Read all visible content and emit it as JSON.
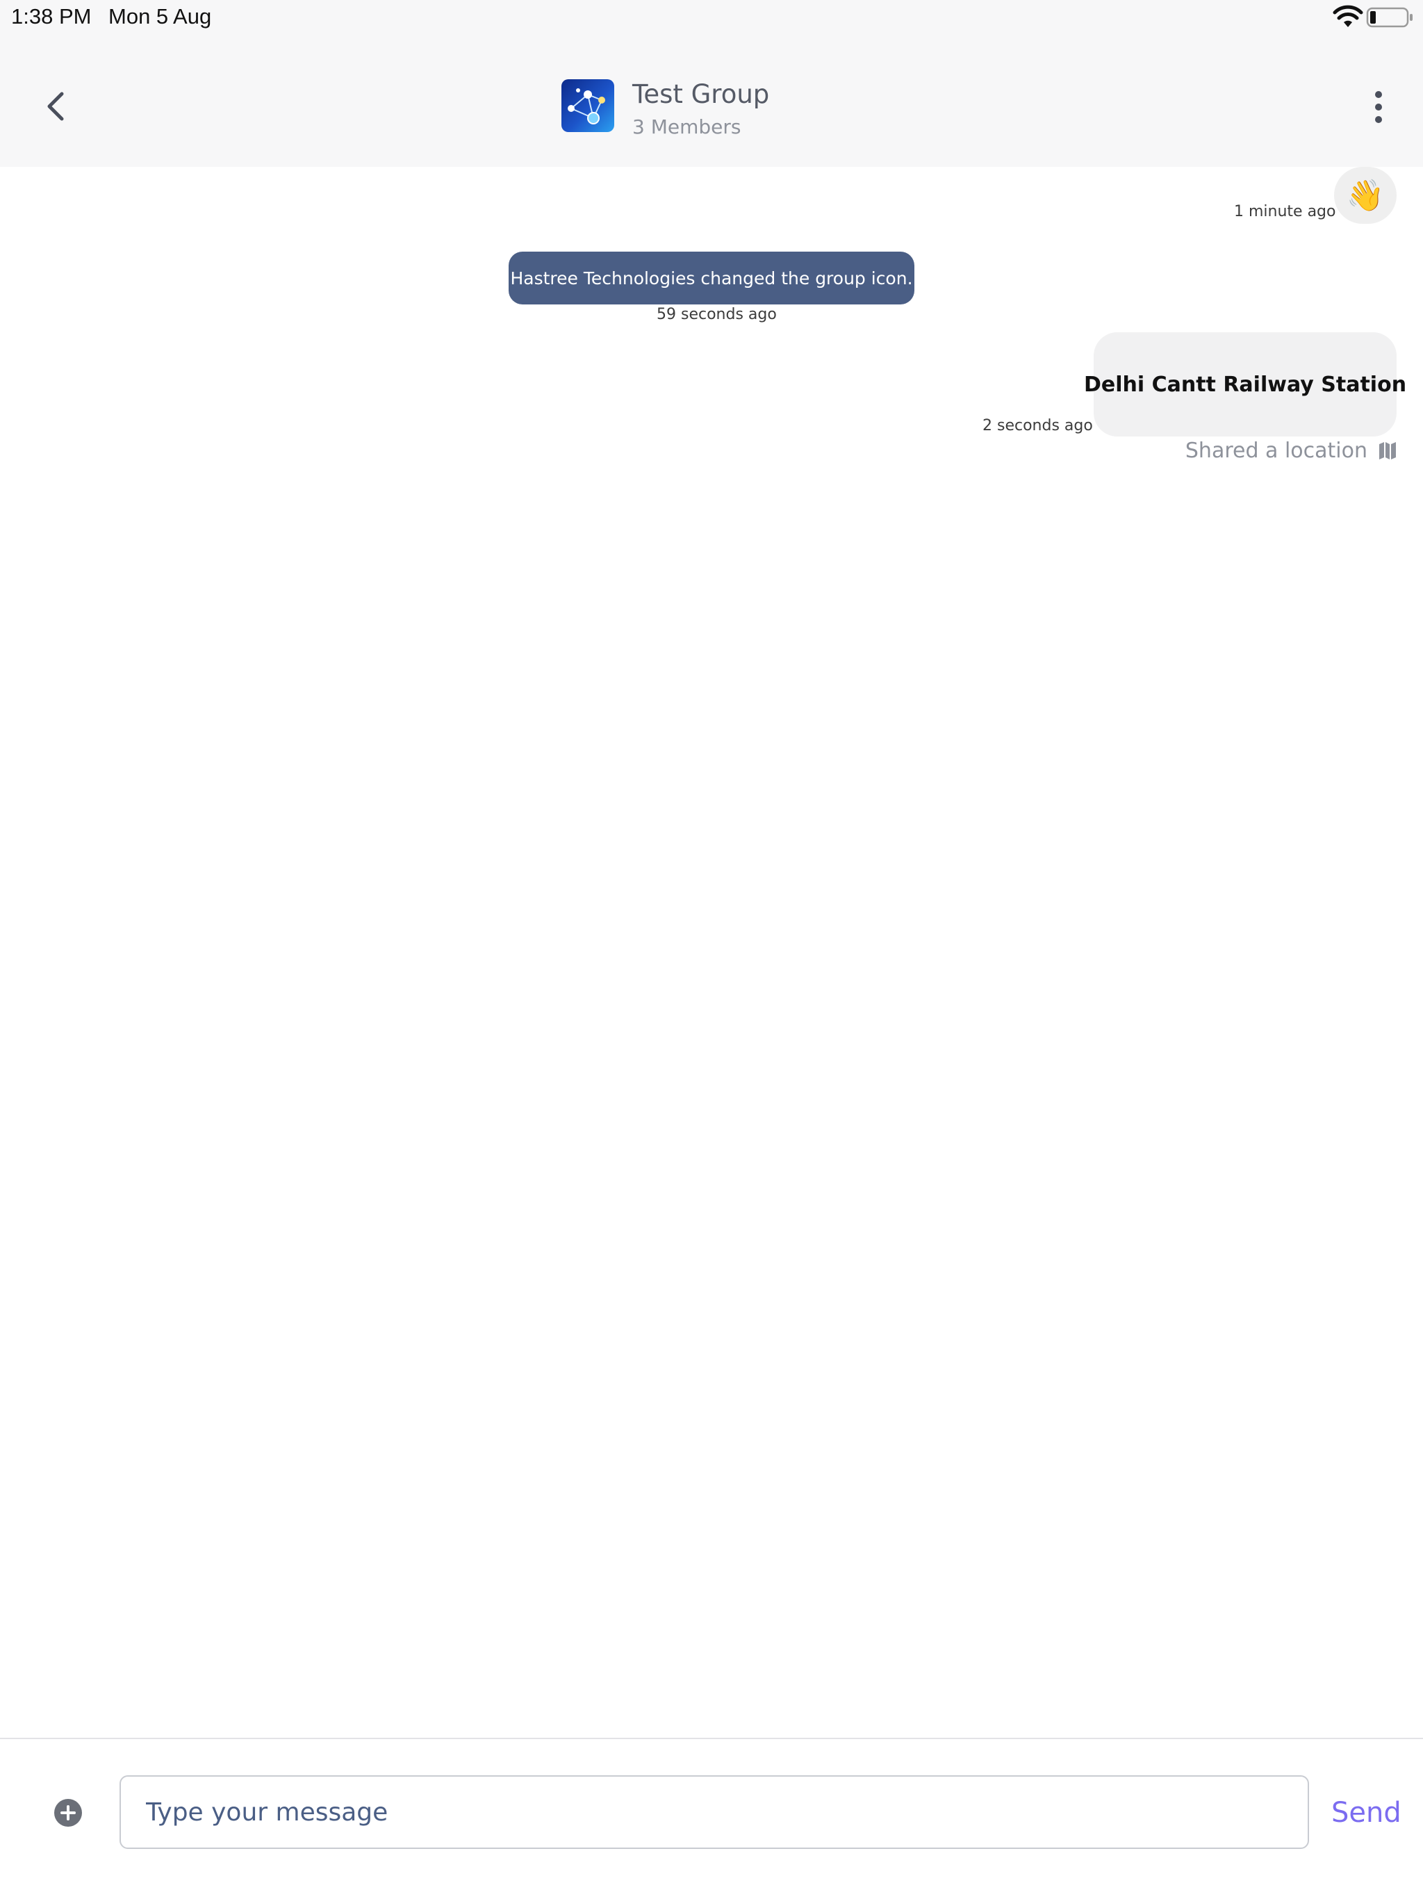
{
  "status_bar": {
    "time": "1:38 PM",
    "date": "Mon 5 Aug",
    "icons": [
      "wifi-icon",
      "battery-icon"
    ]
  },
  "header": {
    "title": "Test Group",
    "subtitle": "3 Members",
    "back_icon": "chevron-left-icon",
    "menu_icon": "more-vertical-icon"
  },
  "messages": [
    {
      "type": "emoji",
      "content": "👋",
      "timestamp": "1 minute ago"
    },
    {
      "type": "system",
      "content": "Hastree Technologies changed the group icon.",
      "timestamp": "59 seconds ago"
    },
    {
      "type": "location",
      "content": "Delhi Cantt Railway Station",
      "timestamp": "2 seconds ago",
      "caption": "Shared a location",
      "caption_icon": "map-icon"
    }
  ],
  "composer": {
    "placeholder": "Type your message",
    "value": "",
    "send_label": "Send",
    "attach_icon": "plus-circle-icon"
  },
  "colors": {
    "system_pill": "#4a5e85",
    "send": "#7b6cf0",
    "header_bg": "#f7f7f8",
    "bubble_bg": "#f1f1f2"
  }
}
